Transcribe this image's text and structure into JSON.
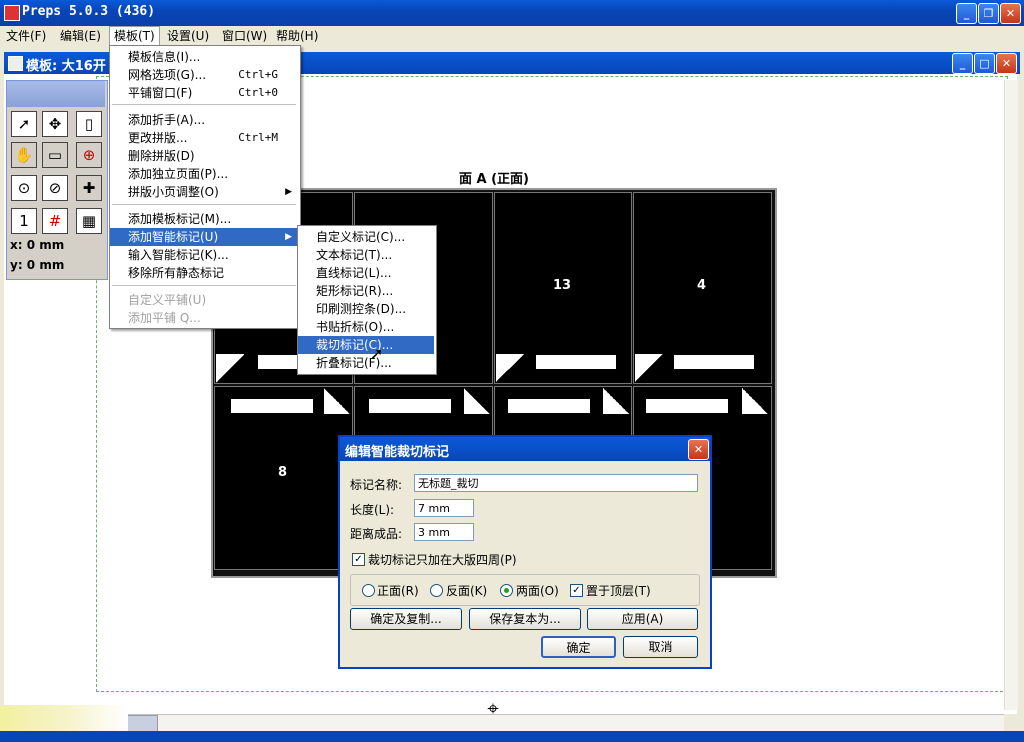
{
  "app": {
    "title": "Preps 5.0.3 (436)"
  },
  "menubar": [
    {
      "label": "文件(F)"
    },
    {
      "label": "编辑(E)"
    },
    {
      "label": "模板(T)"
    },
    {
      "label": "设置(U)"
    },
    {
      "label": "窗口(W)"
    },
    {
      "label": "帮助(H)"
    }
  ],
  "child_window": {
    "title": "模板: 大16开"
  },
  "sheet": {
    "title": "面 A (正面)",
    "page_numbers": {
      "top3": "13",
      "top4": "4",
      "bottom1": "8"
    }
  },
  "toolbox": {
    "x": "x: 0 mm",
    "y": "y: 0 mm"
  },
  "template_menu": {
    "items": [
      {
        "label": "模板信息(I)...",
        "shortcut": ""
      },
      {
        "label": "网格选项(G)...",
        "shortcut": "Ctrl+G"
      },
      {
        "label": "平铺窗口(F)",
        "shortcut": "Ctrl+0"
      },
      {
        "label": "添加折手(A)...",
        "shortcut": ""
      },
      {
        "label": "更改拼版...",
        "shortcut": "Ctrl+M"
      },
      {
        "label": "删除拼版(D)",
        "shortcut": ""
      },
      {
        "label": "添加独立页面(P)...",
        "shortcut": ""
      },
      {
        "label": "拼版小页调整(O)",
        "shortcut": ""
      },
      {
        "label": "添加模板标记(M)...",
        "shortcut": ""
      },
      {
        "label": "添加智能标记(U)",
        "shortcut": ""
      },
      {
        "label": "输入智能标记(K)...",
        "shortcut": ""
      },
      {
        "label": "移除所有静态标记",
        "shortcut": ""
      },
      {
        "label": "自定义平铺(U)",
        "shortcut": ""
      },
      {
        "label": "添加平铺 Q...",
        "shortcut": ""
      }
    ]
  },
  "smart_mark_submenu": {
    "items": [
      {
        "label": "自定义标记(C)..."
      },
      {
        "label": "文本标记(T)..."
      },
      {
        "label": "直线标记(L)..."
      },
      {
        "label": "矩形标记(R)..."
      },
      {
        "label": "印刷测控条(D)..."
      },
      {
        "label": "书贴折标(O)..."
      },
      {
        "label": "裁切标记(C)..."
      },
      {
        "label": "折叠标记(F)..."
      }
    ]
  },
  "dialog": {
    "title": "编辑智能裁切标记",
    "name_label": "标记名称:",
    "name_value": "无标题_裁切",
    "length_label": "长度(L):",
    "length_value": "7 mm",
    "distance_label": "距离成品:",
    "distance_value": "3 mm",
    "edge_only_label": "裁切标记只加在大版四周(P)",
    "radio_front": "正面(R)",
    "radio_back": "反面(K)",
    "radio_both": "两面(O)",
    "top_layer_label": "置于顶层(T)",
    "btn_confirm_copy": "确定及复制...",
    "btn_save_copy": "保存复本为...",
    "btn_apply": "应用(A)",
    "btn_ok": "确定",
    "btn_cancel": "取消"
  }
}
